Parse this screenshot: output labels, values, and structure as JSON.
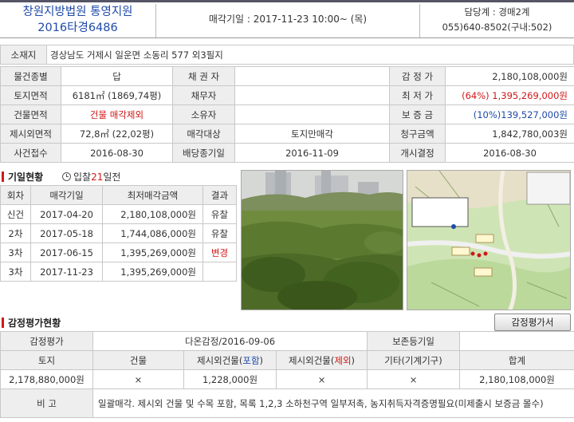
{
  "header": {
    "court_line1": "창원지방법원 통영지원",
    "court_line2": "2016타경6486",
    "auction_date": "매각기일 : 2017-11-23   10:00~ (목)",
    "dept_line1": "담당계 : 경매2계",
    "dept_line2": "055)640-8502(구내:502)"
  },
  "address": {
    "label": "소재지",
    "value": "경상남도 거제시 일운면 소동리 577 외3필지"
  },
  "summary": {
    "row1": {
      "l1": "물건종별",
      "v1": "답",
      "l2": "채 권 자",
      "v2": "",
      "l3": "감 정 가",
      "v3": "2,180,108,000원"
    },
    "row2": {
      "l1": "토지면적",
      "v1": "6181㎡ (1869,74평)",
      "l2": "채무자",
      "v2": "",
      "l3": "최 저 가",
      "v3": "(64%) 1,395,269,000원"
    },
    "row3": {
      "l1": "건물면적",
      "v1": "건물 매각제외",
      "l2": "소유자",
      "v2": "",
      "l3": "보 증 금",
      "v3": "(10%)139,527,000원"
    },
    "row4": {
      "l1": "제시외면적",
      "v1": "72,8㎡ (22,02평)",
      "l2": "매각대상",
      "v2": "토지만매각",
      "l3": "청구금액",
      "v3": "1,842,780,003원"
    },
    "row5": {
      "l1": "사건접수",
      "v1": "2016-08-30",
      "l2": "배당종기일",
      "v2": "2016-11-09",
      "l3": "개시결정",
      "v3": "2016-08-30"
    }
  },
  "history": {
    "title": "기일현황",
    "button_prefix": "입찰",
    "button_days": "21",
    "button_suffix": "일전",
    "headers": [
      "회차",
      "매각기일",
      "최저매각금액",
      "결과"
    ],
    "rows": [
      {
        "round": "신건",
        "date": "2017-04-20",
        "price": "2,180,108,000원",
        "result": "유찰"
      },
      {
        "round": "2차",
        "date": "2017-05-18",
        "price": "1,744,086,000원",
        "result": "유찰"
      },
      {
        "round": "3차",
        "date": "2017-06-15",
        "price": "1,395,269,000원",
        "result": "변경"
      },
      {
        "round": "3차",
        "date": "2017-11-23",
        "price": "1,395,269,000원",
        "result": ""
      }
    ]
  },
  "appraisal": {
    "title": "감정평가현황",
    "button_label": "감정평가서",
    "row1": {
      "l1": "감정평가",
      "v1": "다온감정/2016-09-06",
      "l2": "보존등기일",
      "v2": ""
    },
    "headers": {
      "land": "토지",
      "building": "건물",
      "extra_inc_pre": "제시외건물(",
      "extra_inc": "포함",
      "extra_inc_post": ")",
      "extra_exc_pre": "제시외건물(",
      "extra_exc": "제외",
      "extra_exc_post": ")",
      "other": "기타(기계기구)",
      "total": "합계"
    },
    "values": {
      "land": "2,178,880,000원",
      "building": "×",
      "extra_inc": "1,228,000원",
      "extra_exc": "×",
      "other": "×",
      "total": "2,180,108,000원"
    },
    "note_label": "비 고",
    "note": "일괄매각. 제시외 건물 및 수목 포함, 목록 1,2,3 소하천구역 일부저촉, 농지취득자격증명필요(미제출시 보증금 몰수)"
  },
  "colors": {
    "court_blue": "#1f4aa8",
    "alert_red": "#d01818",
    "label_bg": "#eeeeee"
  }
}
